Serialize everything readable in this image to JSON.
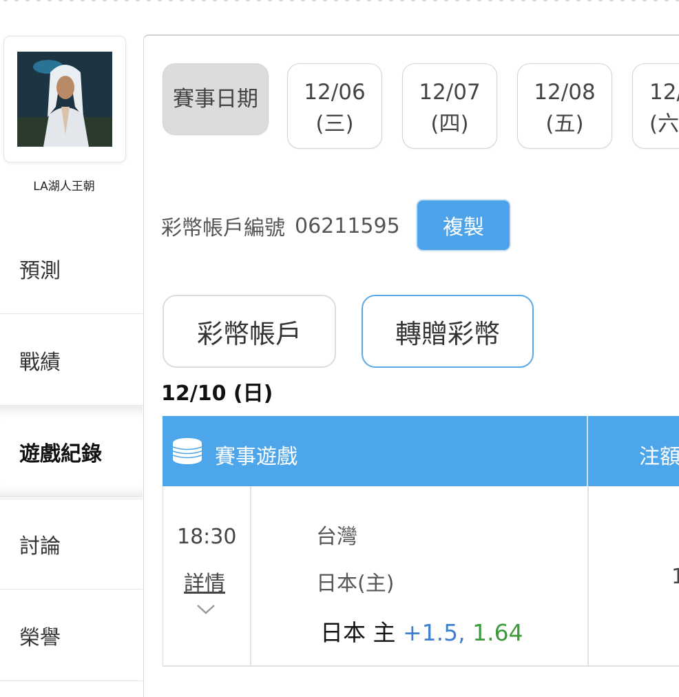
{
  "user": {
    "name": "LA湖人王朝"
  },
  "nav": {
    "items": [
      {
        "label": "預測"
      },
      {
        "label": "戰績"
      },
      {
        "label": "遊戲紀錄"
      },
      {
        "label": "討論"
      },
      {
        "label": "榮譽"
      }
    ],
    "active_index": 2
  },
  "dates": {
    "label": "賽事日期",
    "items": [
      {
        "date": "12/06",
        "weekday": "(三)"
      },
      {
        "date": "12/07",
        "weekday": "(四)"
      },
      {
        "date": "12/08",
        "weekday": "(五)"
      },
      {
        "date": "12/",
        "weekday": "(六"
      }
    ]
  },
  "account": {
    "label": "彩幣帳戶編號",
    "number": "06211595",
    "copy_label": "複製"
  },
  "buttons": {
    "account": "彩幣帳戶",
    "transfer": "轉贈彩幣"
  },
  "section_date": "12/10 (日)",
  "table": {
    "header": {
      "game": "賽事遊戲",
      "amount": "注額"
    },
    "rows": [
      {
        "time": "18:30",
        "detail_label": "詳情",
        "team_away": "台灣",
        "team_home": "日本(主)",
        "pick_team": "日本 主",
        "pick_spread": "+1.5,",
        "pick_odds": "1.64",
        "amount": "1"
      }
    ]
  },
  "colors": {
    "accent": "#4da6ea",
    "spread": "#3d7fd1",
    "odds": "#3c9a3c"
  }
}
